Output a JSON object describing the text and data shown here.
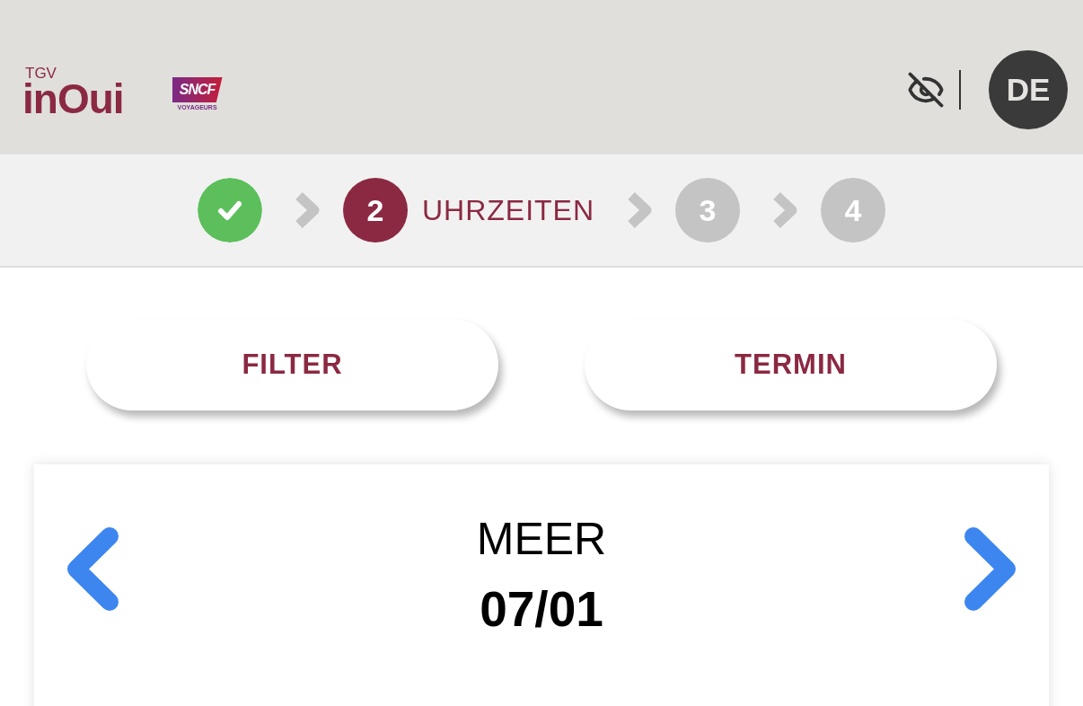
{
  "header": {
    "logos": [
      {
        "kind": "wordmark",
        "small_text": "TGV",
        "main_text": "inOui"
      },
      {
        "kind": "badge",
        "main_text": "SNCF",
        "sub_text": "VOYAGEURS"
      }
    ],
    "language_button": {
      "label": "DE"
    }
  },
  "stepper": {
    "steps": [
      {
        "completed": true,
        "selected": false
      },
      {
        "number": "2",
        "label": "UHRZEITEN",
        "completed": false,
        "selected": true
      },
      {
        "number": "3",
        "completed": false,
        "selected": false
      },
      {
        "number": "4",
        "completed": false,
        "selected": false
      }
    ]
  },
  "filter_button": {
    "label": "FILTER"
  },
  "date_button": {
    "label": "TERMIN"
  },
  "date_card": {
    "title": "MEER",
    "date": "07/01"
  }
}
